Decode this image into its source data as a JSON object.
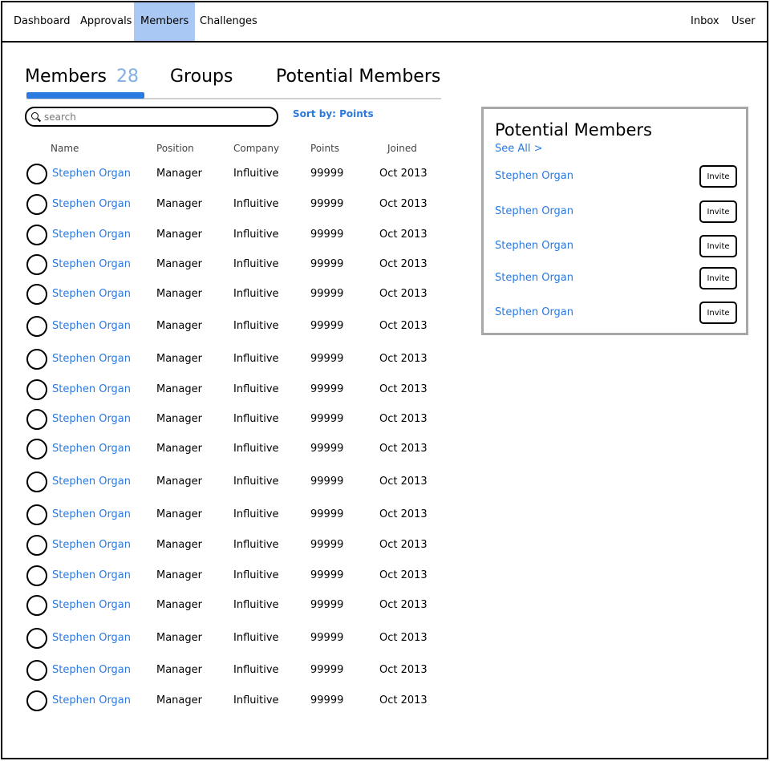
{
  "nav": {
    "items": [
      {
        "label": "Dashboard",
        "active": false
      },
      {
        "label": "Approvals",
        "active": false
      },
      {
        "label": "Members",
        "active": true
      },
      {
        "label": "Challenges",
        "active": false
      }
    ],
    "right": [
      {
        "label": "Inbox"
      },
      {
        "label": "User"
      }
    ]
  },
  "tabs": {
    "members_label": "Members",
    "members_count": "28",
    "groups_label": "Groups",
    "potential_label": "Potential Members"
  },
  "search": {
    "placeholder": "search",
    "value": ""
  },
  "sort": {
    "label": "Sort by: Points"
  },
  "table": {
    "headers": [
      "Name",
      "Position",
      "Company",
      "Points",
      "Joined"
    ],
    "rows": [
      {
        "name": "Stephen Organ",
        "position": "Manager",
        "company": "Influitive",
        "points": "99999",
        "joined": "Oct 2013"
      },
      {
        "name": "Stephen Organ",
        "position": "Manager",
        "company": "Influitive",
        "points": "99999",
        "joined": "Oct 2013"
      },
      {
        "name": "Stephen Organ",
        "position": "Manager",
        "company": "Influitive",
        "points": "99999",
        "joined": "Oct 2013"
      },
      {
        "name": "Stephen Organ",
        "position": "Manager",
        "company": "Influitive",
        "points": "99999",
        "joined": "Oct 2013"
      },
      {
        "name": "Stephen Organ",
        "position": "Manager",
        "company": "Influitive",
        "points": "99999",
        "joined": "Oct 2013"
      },
      {
        "name": "Stephen Organ",
        "position": "Manager",
        "company": "Influitive",
        "points": "99999",
        "joined": "Oct 2013"
      },
      {
        "name": "Stephen Organ",
        "position": "Manager",
        "company": "Influitive",
        "points": "99999",
        "joined": "Oct 2013"
      },
      {
        "name": "Stephen Organ",
        "position": "Manager",
        "company": "Influitive",
        "points": "99999",
        "joined": "Oct 2013"
      },
      {
        "name": "Stephen Organ",
        "position": "Manager",
        "company": "Influitive",
        "points": "99999",
        "joined": "Oct 2013"
      },
      {
        "name": "Stephen Organ",
        "position": "Manager",
        "company": "Influitive",
        "points": "99999",
        "joined": "Oct 2013"
      },
      {
        "name": "Stephen Organ",
        "position": "Manager",
        "company": "Influitive",
        "points": "99999",
        "joined": "Oct 2013"
      },
      {
        "name": "Stephen Organ",
        "position": "Manager",
        "company": "Influitive",
        "points": "99999",
        "joined": "Oct 2013"
      },
      {
        "name": "Stephen Organ",
        "position": "Manager",
        "company": "Influitive",
        "points": "99999",
        "joined": "Oct 2013"
      },
      {
        "name": "Stephen Organ",
        "position": "Manager",
        "company": "Influitive",
        "points": "99999",
        "joined": "Oct 2013"
      },
      {
        "name": "Stephen Organ",
        "position": "Manager",
        "company": "Influitive",
        "points": "99999",
        "joined": "Oct 2013"
      },
      {
        "name": "Stephen Organ",
        "position": "Manager",
        "company": "Influitive",
        "points": "99999",
        "joined": "Oct 2013"
      },
      {
        "name": "Stephen Organ",
        "position": "Manager",
        "company": "Influitive",
        "points": "99999",
        "joined": "Oct 2013"
      },
      {
        "name": "Stephen Organ",
        "position": "Manager",
        "company": "Influitive",
        "points": "99999",
        "joined": "Oct 2013"
      }
    ]
  },
  "panel": {
    "title": "Potential Members",
    "see_all": "See All >",
    "invite_label": "Invite",
    "items": [
      {
        "name": "Stephen Organ"
      },
      {
        "name": "Stephen Organ"
      },
      {
        "name": "Stephen Organ"
      },
      {
        "name": "Stephen Organ"
      },
      {
        "name": "Stephen Organ"
      }
    ]
  },
  "colors": {
    "accent": "#2a7ae0",
    "nav_active": "#a9c8f3",
    "count": "#7fb0e6",
    "panel_border": "#a7a7a7"
  }
}
